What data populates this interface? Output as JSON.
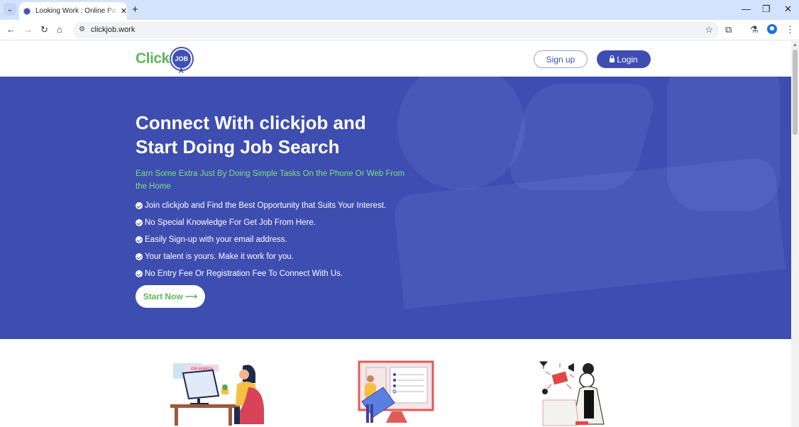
{
  "browser": {
    "tab_title": "Looking Work : Online Part Time",
    "tab_close": "✕",
    "new_tab": "+",
    "tab_list": "⌄",
    "url": "clickjob.work",
    "window_controls": {
      "minimize": "—",
      "restore": "❐",
      "close": "✕"
    },
    "icons": {
      "back": "←",
      "forward": "→",
      "reload": "↻",
      "home": "⌂",
      "site_info": "⚙",
      "bookmark": "☆",
      "extensions": "⧉",
      "labs": "⚗",
      "menu": "⋮"
    }
  },
  "header": {
    "logo_text": "Click",
    "logo_badge": "JOB",
    "signup_label": "Sign up",
    "login_label": "Login"
  },
  "hero": {
    "title": "Connect With clickjob and Start Doing Job Search",
    "subtitle": "Earn Some Extra Just By Doing Simple Tasks On the Phone Or Web From the Home",
    "features": [
      "Join clickjob and Find the Best Opportunity that Suits Your Interest.",
      "No Special Knowledge For Get Job From Here.",
      "Easily Sign-up with your email address.",
      "Your talent is yours. Make it work for you.",
      "No Entry Fee Or Registration Fee To Connect With Us."
    ],
    "cta_label": "Start Now ⟶"
  },
  "illustrations": {
    "one_label": "JOB SEARCH"
  },
  "colors": {
    "brand_blue": "#3d4db0",
    "brand_green": "#5cb85c"
  }
}
